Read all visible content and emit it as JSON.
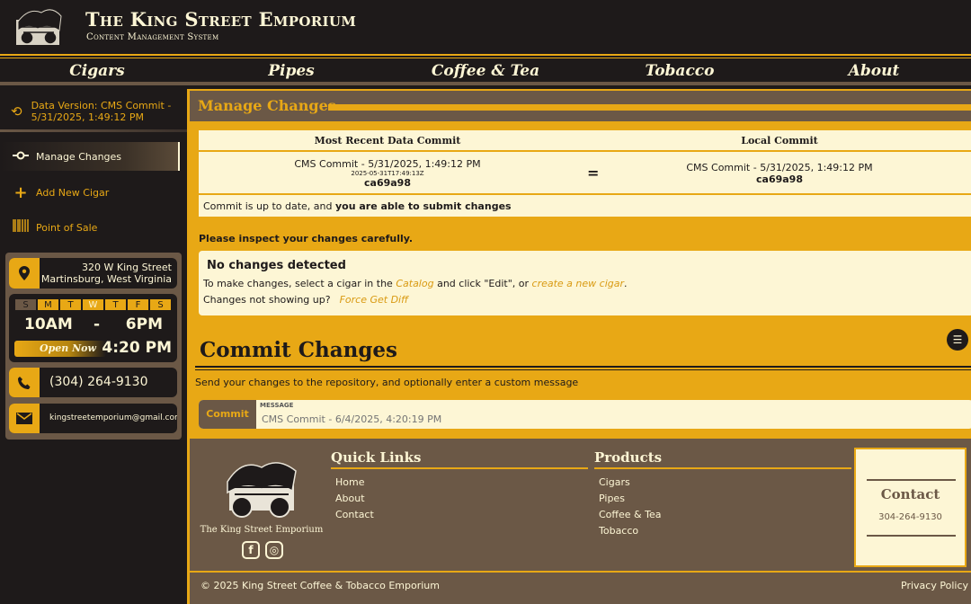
{
  "header": {
    "title": "The King Street Emporium",
    "subtitle": "Content Management System"
  },
  "nav": [
    "Cigars",
    "Pipes",
    "Coffee & Tea",
    "Tobacco",
    "About"
  ],
  "sidebar": {
    "data_version": "Data Version: CMS Commit - 5/31/2025, 1:49:12 PM",
    "items": [
      {
        "label": "Manage Changes",
        "icon": "commit-icon",
        "active": true
      },
      {
        "label": "Add New Cigar",
        "icon": "plus-icon",
        "active": false
      },
      {
        "label": "Point of Sale",
        "icon": "barcode-icon",
        "active": false
      }
    ],
    "address_line1": "320 W King Street",
    "address_line2": "Martinsburg, West Virginia",
    "days": [
      "S",
      "M",
      "T",
      "W",
      "T",
      "F",
      "S"
    ],
    "hours_open": "10AM",
    "hours_dash": "-",
    "hours_close": "6PM",
    "open_status": "Open Now",
    "current_time": "4:20 PM",
    "phone": "(304) 264-9130",
    "email": "kingstreetemporium@gmail.com"
  },
  "main": {
    "section_title": "Manage Changes",
    "recent_header": "Most Recent Data Commit",
    "local_header": "Local Commit",
    "recent_commit": "CMS Commit - 5/31/2025, 1:49:12 PM",
    "recent_timestamp": "2025-05-31T17:49:13Z",
    "recent_hash": "ca69a98",
    "equals": "=",
    "local_commit": "CMS Commit - 5/31/2025, 1:49:12 PM",
    "local_hash": "ca69a98",
    "status_prefix": "Commit is up to date, and ",
    "status_bold": "you are able to submit changes",
    "inspect_note": "Please inspect your changes carefully.",
    "no_changes_title": "No changes detected",
    "instr_part1": "To make changes, select a cigar in the ",
    "instr_catalog": "Catalog",
    "instr_part2": " and click \"Edit\", or ",
    "instr_create": "create a new cigar",
    "instr_part3": ".",
    "not_showing": "Changes not showing up?",
    "force_diff": "Force Get Diff",
    "commit_title": "Commit Changes",
    "commit_desc": "Send your changes to the repository, and optionally enter a custom message",
    "commit_button": "Commit",
    "message_label": "MESSAGE",
    "message_placeholder": "CMS Commit - 6/4/2025, 4:20:19 PM"
  },
  "footer": {
    "brand": "The King Street Emporium",
    "quick_links_title": "Quick Links",
    "quick_links": [
      "Home",
      "About",
      "Contact"
    ],
    "products_title": "Products",
    "products": [
      "Cigars",
      "Pipes",
      "Coffee & Tea",
      "Tobacco"
    ],
    "contact_title": "Contact",
    "contact_phone": "304-264-9130",
    "copyright": "© 2025 King Street Coffee & Tobacco Emporium",
    "privacy": "Privacy Policy"
  },
  "colors": {
    "gold": "#e8a815",
    "dark": "#1e1a1a",
    "brown": "#6b5846",
    "cream": "#fdf6d5"
  }
}
